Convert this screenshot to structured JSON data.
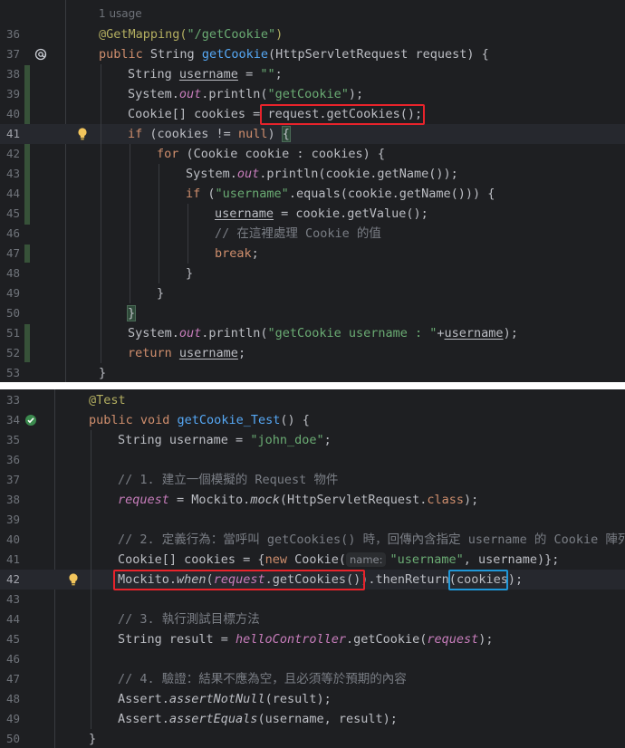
{
  "top_panel": {
    "usage_hint": "1 usage",
    "highlighted_line": "41",
    "lines": [
      {
        "n": "36",
        "indent": 0,
        "tokens": [
          {
            "t": "@GetMapping(",
            "c": "ann"
          },
          {
            "t": "\"/getCookie\"",
            "c": "str"
          },
          {
            "t": ")",
            "c": "ann"
          }
        ]
      },
      {
        "n": "37",
        "indent": 0,
        "tokens": [
          {
            "t": "public ",
            "c": "kw"
          },
          {
            "t": "String "
          },
          {
            "t": "getCookie",
            "c": "fn"
          },
          {
            "t": "(HttpServletRequest request) {"
          }
        ]
      },
      {
        "n": "38",
        "indent": 1,
        "tokens": [
          {
            "t": "String "
          },
          {
            "t": "username",
            "c": "und"
          },
          {
            "t": " = "
          },
          {
            "t": "\"\"",
            "c": "str"
          },
          {
            "t": ";"
          }
        ]
      },
      {
        "n": "39",
        "indent": 1,
        "tokens": [
          {
            "t": "System."
          },
          {
            "t": "out",
            "c": "st"
          },
          {
            "t": ".println("
          },
          {
            "t": "\"getCookie\"",
            "c": "str"
          },
          {
            "t": ");"
          }
        ]
      },
      {
        "n": "40",
        "indent": 1,
        "tokens": [
          {
            "t": "Cookie[] cookies = "
          },
          {
            "t": "request.getCookies();"
          }
        ]
      },
      {
        "n": "41",
        "indent": 1,
        "tokens": [
          {
            "t": "if ",
            "c": "kw"
          },
          {
            "t": "(cookies != "
          },
          {
            "t": "null",
            "c": "kw"
          },
          {
            "t": ") "
          },
          {
            "t": "{",
            "c": "brk"
          }
        ]
      },
      {
        "n": "42",
        "indent": 2,
        "tokens": [
          {
            "t": "for ",
            "c": "kw"
          },
          {
            "t": "(Cookie cookie : cookies) {"
          }
        ]
      },
      {
        "n": "43",
        "indent": 3,
        "tokens": [
          {
            "t": "System."
          },
          {
            "t": "out",
            "c": "st"
          },
          {
            "t": ".println(cookie.getName());"
          }
        ]
      },
      {
        "n": "44",
        "indent": 3,
        "tokens": [
          {
            "t": "if ",
            "c": "kw"
          },
          {
            "t": "("
          },
          {
            "t": "\"username\"",
            "c": "str"
          },
          {
            "t": ".equals(cookie.getName())) {"
          }
        ]
      },
      {
        "n": "45",
        "indent": 4,
        "tokens": [
          {
            "t": "username",
            "c": "und"
          },
          {
            "t": " = cookie.getValue();"
          }
        ]
      },
      {
        "n": "46",
        "indent": 4,
        "tokens": [
          {
            "t": "// ",
            "c": "cmt"
          },
          {
            "t": "在這裡處理",
            "c": "cmt cjk"
          },
          {
            "t": " Cookie ",
            "c": "cmt"
          },
          {
            "t": "的值",
            "c": "cmt cjk"
          }
        ]
      },
      {
        "n": "47",
        "indent": 4,
        "tokens": [
          {
            "t": "break",
            "c": "kw"
          },
          {
            "t": ";"
          }
        ]
      },
      {
        "n": "48",
        "indent": 3,
        "tokens": [
          {
            "t": "}"
          }
        ]
      },
      {
        "n": "49",
        "indent": 2,
        "tokens": [
          {
            "t": "}"
          }
        ]
      },
      {
        "n": "50",
        "indent": 1,
        "tokens": [
          {
            "t": "}",
            "c": "brk"
          }
        ]
      },
      {
        "n": "51",
        "indent": 1,
        "tokens": [
          {
            "t": "System."
          },
          {
            "t": "out",
            "c": "st"
          },
          {
            "t": ".println("
          },
          {
            "t": "\"getCookie username : \"",
            "c": "str"
          },
          {
            "t": "+"
          },
          {
            "t": "username",
            "c": "und"
          },
          {
            "t": ");"
          }
        ]
      },
      {
        "n": "52",
        "indent": 1,
        "tokens": [
          {
            "t": "return ",
            "c": "kw"
          },
          {
            "t": "username",
            "c": "und"
          },
          {
            "t": ";"
          }
        ]
      },
      {
        "n": "53",
        "indent": 0,
        "tokens": [
          {
            "t": "}"
          }
        ]
      }
    ]
  },
  "bottom_panel": {
    "highlighted_line": "42",
    "lines": [
      {
        "n": "33",
        "indent": 0,
        "tokens": [
          {
            "t": "@Test",
            "c": "ann"
          }
        ]
      },
      {
        "n": "34",
        "indent": 0,
        "tokens": [
          {
            "t": "public void ",
            "c": "kw"
          },
          {
            "t": "getCookie_Test",
            "c": "fn"
          },
          {
            "t": "() {"
          }
        ]
      },
      {
        "n": "35",
        "indent": 1,
        "tokens": [
          {
            "t": "String username = "
          },
          {
            "t": "\"john_doe\"",
            "c": "str"
          },
          {
            "t": ";"
          }
        ]
      },
      {
        "n": "36",
        "indent": 1,
        "tokens": []
      },
      {
        "n": "37",
        "indent": 1,
        "tokens": [
          {
            "t": "// 1. ",
            "c": "cmt"
          },
          {
            "t": "建立一個模擬的",
            "c": "cmt cjk"
          },
          {
            "t": " Request ",
            "c": "cmt"
          },
          {
            "t": "物件",
            "c": "cmt cjk"
          }
        ]
      },
      {
        "n": "38",
        "indent": 1,
        "tokens": [
          {
            "t": "request",
            "c": "st"
          },
          {
            "t": " = Mockito."
          },
          {
            "t": "mock",
            "c": "ital"
          },
          {
            "t": "(HttpServletRequest."
          },
          {
            "t": "class",
            "c": "kw"
          },
          {
            "t": ");"
          }
        ]
      },
      {
        "n": "39",
        "indent": 1,
        "tokens": []
      },
      {
        "n": "40",
        "indent": 1,
        "tokens": [
          {
            "t": "// 2. ",
            "c": "cmt"
          },
          {
            "t": "定義行為：當呼叫",
            "c": "cmt cjk"
          },
          {
            "t": " getCookies() ",
            "c": "cmt"
          },
          {
            "t": "時，回傳內含指定",
            "c": "cmt cjk"
          },
          {
            "t": " username ",
            "c": "cmt"
          },
          {
            "t": "的",
            "c": "cmt cjk"
          },
          {
            "t": " Cookie ",
            "c": "cmt"
          },
          {
            "t": "陣列",
            "c": "cmt cjk"
          }
        ]
      },
      {
        "n": "41",
        "indent": 1,
        "tokens": [
          {
            "t": "Cookie[] cookies = {"
          },
          {
            "t": "new ",
            "c": "kw"
          },
          {
            "t": "Cookie("
          },
          {
            "t": "name:",
            "c": "hint"
          },
          {
            "t": "\"username\"",
            "c": "str"
          },
          {
            "t": ", username)};"
          }
        ]
      },
      {
        "n": "42",
        "indent": 1,
        "tokens": [
          {
            "t": "Mockito."
          },
          {
            "t": "when",
            "c": "ital"
          },
          {
            "t": "("
          },
          {
            "t": "request",
            "c": "st"
          },
          {
            "t": ".getCookies())"
          },
          {
            "t": ".thenReturn("
          },
          {
            "t": "cookies"
          },
          {
            "t": ");"
          }
        ]
      },
      {
        "n": "43",
        "indent": 1,
        "tokens": []
      },
      {
        "n": "44",
        "indent": 1,
        "tokens": [
          {
            "t": "// 3. ",
            "c": "cmt"
          },
          {
            "t": "執行測試目標方法",
            "c": "cmt cjk"
          }
        ]
      },
      {
        "n": "45",
        "indent": 1,
        "tokens": [
          {
            "t": "String result = "
          },
          {
            "t": "helloController",
            "c": "st"
          },
          {
            "t": ".getCookie("
          },
          {
            "t": "request",
            "c": "st"
          },
          {
            "t": ");"
          }
        ]
      },
      {
        "n": "46",
        "indent": 1,
        "tokens": []
      },
      {
        "n": "47",
        "indent": 1,
        "tokens": [
          {
            "t": "// 4. ",
            "c": "cmt"
          },
          {
            "t": "驗證：結果不應為空，且必須等於預期的內容",
            "c": "cmt cjk"
          }
        ]
      },
      {
        "n": "48",
        "indent": 1,
        "tokens": [
          {
            "t": "Assert."
          },
          {
            "t": "assertNotNull",
            "c": "ital"
          },
          {
            "t": "(result);"
          }
        ]
      },
      {
        "n": "49",
        "indent": 1,
        "tokens": [
          {
            "t": "Assert."
          },
          {
            "t": "assertEquals",
            "c": "ital"
          },
          {
            "t": "(username, result);"
          }
        ]
      },
      {
        "n": "50",
        "indent": 0,
        "tokens": [
          {
            "t": "}"
          }
        ]
      }
    ]
  }
}
